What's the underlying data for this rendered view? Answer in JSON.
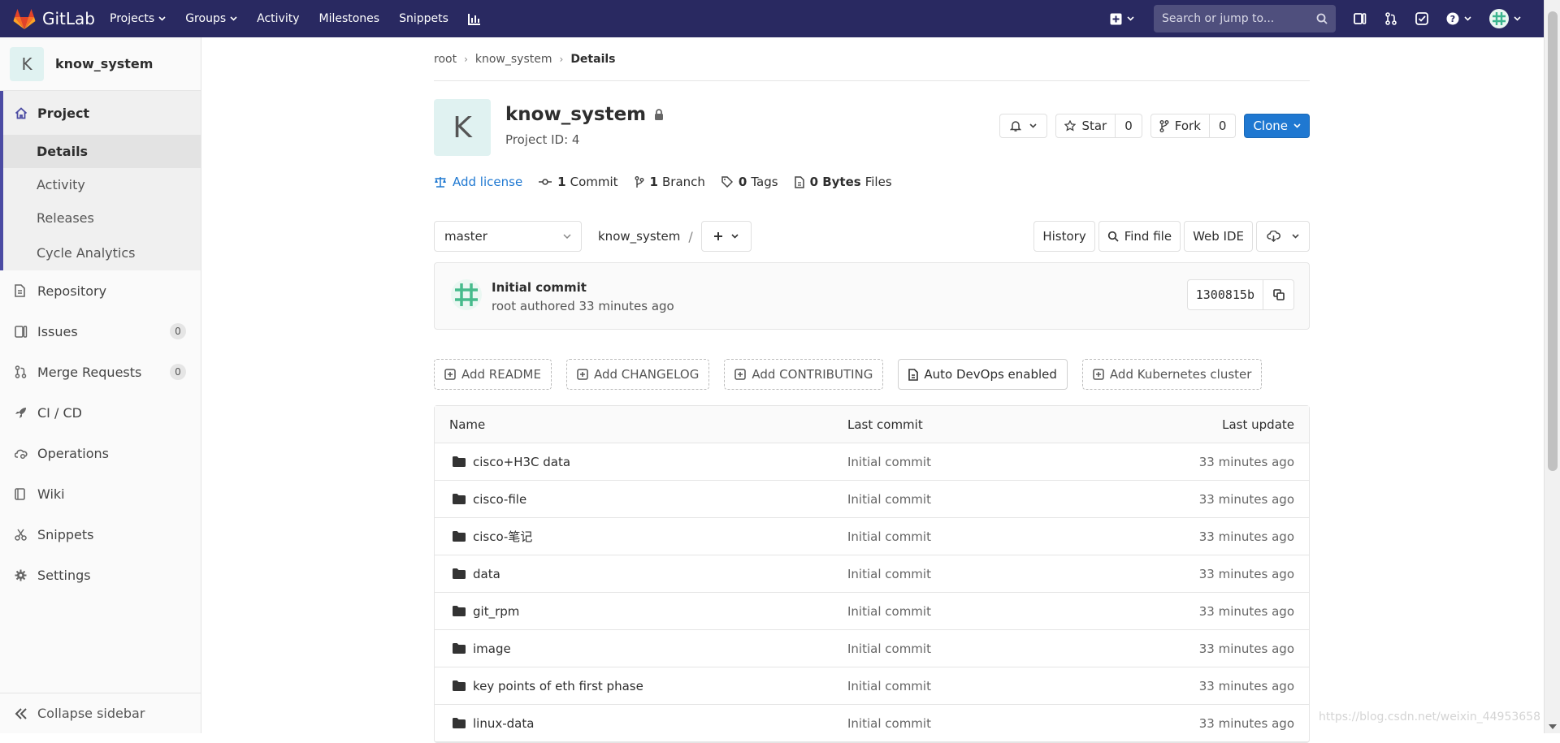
{
  "navbar": {
    "brand": "GitLab",
    "links": [
      "Projects",
      "Groups",
      "Activity",
      "Milestones",
      "Snippets"
    ],
    "search_placeholder": "Search or jump to..."
  },
  "sidebar": {
    "project_initial": "K",
    "project_name": "know_system",
    "project_label": "Project",
    "sub_items": [
      "Details",
      "Activity",
      "Releases",
      "Cycle Analytics"
    ],
    "items": [
      {
        "label": "Repository"
      },
      {
        "label": "Issues",
        "count": "0"
      },
      {
        "label": "Merge Requests",
        "count": "0"
      },
      {
        "label": "CI / CD"
      },
      {
        "label": "Operations"
      },
      {
        "label": "Wiki"
      },
      {
        "label": "Snippets"
      },
      {
        "label": "Settings"
      }
    ],
    "collapse_label": "Collapse sidebar"
  },
  "breadcrumb": [
    "root",
    "know_system",
    "Details"
  ],
  "project": {
    "initial": "K",
    "name": "know_system",
    "id_label": "Project ID: 4",
    "star_label": "Star",
    "star_count": "0",
    "fork_label": "Fork",
    "fork_count": "0",
    "clone_label": "Clone"
  },
  "stats": {
    "add_license": "Add license",
    "commits_num": "1",
    "commits_label": "Commit",
    "branches_num": "1",
    "branches_label": "Branch",
    "tags_num": "0",
    "tags_label": "Tags",
    "bytes_num": "0 Bytes",
    "files_label": "Files"
  },
  "tree": {
    "branch": "master",
    "path": "know_system",
    "path_sep": "/",
    "history": "History",
    "find_file": "Find file",
    "web_ide": "Web IDE"
  },
  "commit": {
    "title": "Initial commit",
    "author": "root",
    "authored_text": "authored 33 minutes ago",
    "sha": "1300815b"
  },
  "quick_actions": [
    "Add README",
    "Add CHANGELOG",
    "Add CONTRIBUTING",
    "Auto DevOps enabled",
    "Add Kubernetes cluster"
  ],
  "table": {
    "headers": [
      "Name",
      "Last commit",
      "Last update"
    ],
    "rows": [
      {
        "name": "cisco+H3C data",
        "commit": "Initial commit",
        "updated": "33 minutes ago"
      },
      {
        "name": "cisco-file",
        "commit": "Initial commit",
        "updated": "33 minutes ago"
      },
      {
        "name": "cisco-笔记",
        "commit": "Initial commit",
        "updated": "33 minutes ago"
      },
      {
        "name": "data",
        "commit": "Initial commit",
        "updated": "33 minutes ago"
      },
      {
        "name": "git_rpm",
        "commit": "Initial commit",
        "updated": "33 minutes ago"
      },
      {
        "name": "image",
        "commit": "Initial commit",
        "updated": "33 minutes ago"
      },
      {
        "name": "key points of eth first phase",
        "commit": "Initial commit",
        "updated": "33 minutes ago"
      },
      {
        "name": "linux-data",
        "commit": "Initial commit",
        "updated": "33 minutes ago"
      }
    ]
  },
  "watermark": "https://blog.csdn.net/weixin_44953658",
  "colors": {
    "navbar": "#292961",
    "primary": "#1f78d1",
    "accent": "#4b4ba3",
    "logo": "#e24329"
  }
}
